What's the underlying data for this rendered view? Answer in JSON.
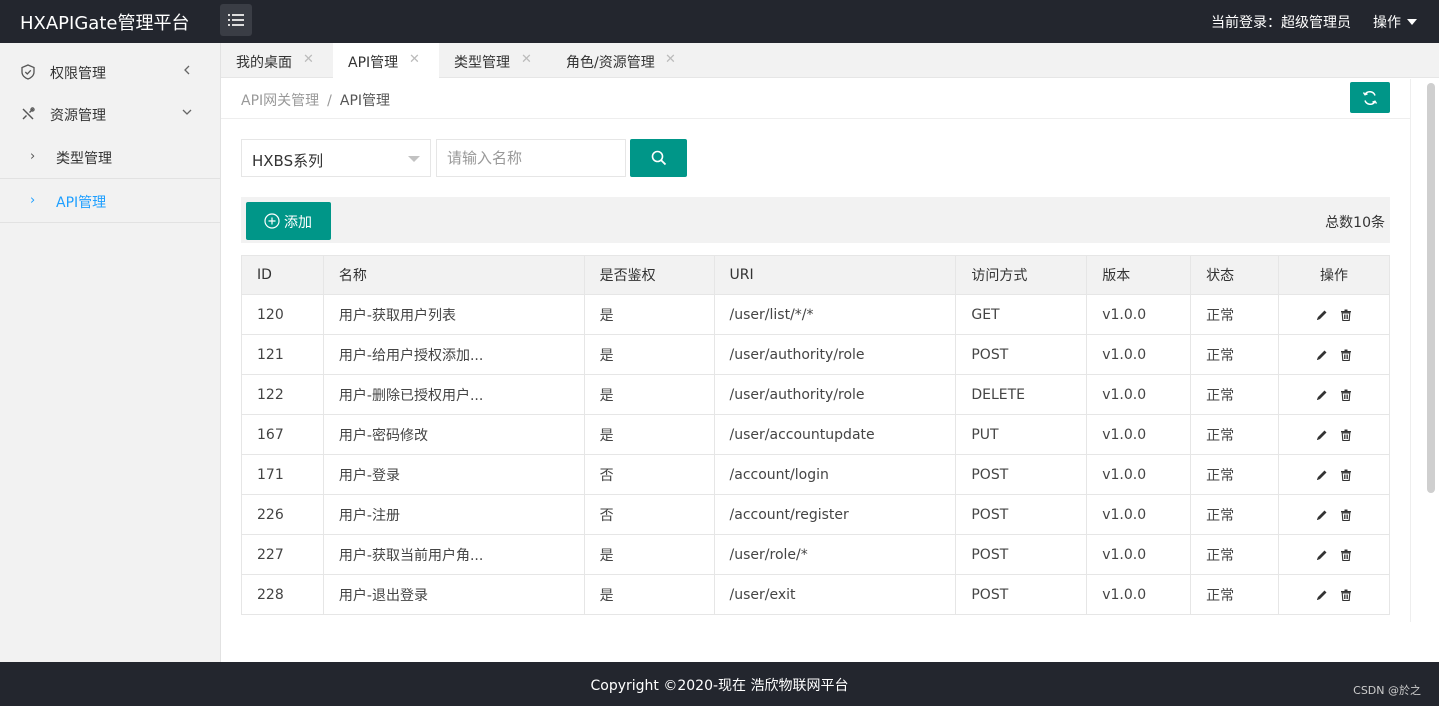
{
  "app": {
    "title": "HXAPIGate管理平台"
  },
  "header": {
    "login_text": "当前登录：超级管理员",
    "ops_label": "操作"
  },
  "sidebar": {
    "items": [
      {
        "label": "权限管理",
        "icon": "shield-check-icon",
        "arrow": "chevron-left-icon"
      },
      {
        "label": "资源管理",
        "icon": "tools-icon",
        "arrow": "chevron-down-icon"
      }
    ],
    "sub_items": [
      {
        "label": "类型管理",
        "active": false
      },
      {
        "label": "API管理",
        "active": true
      }
    ]
  },
  "tabs": [
    {
      "label": "我的桌面",
      "active": false
    },
    {
      "label": "API管理",
      "active": true
    },
    {
      "label": "类型管理",
      "active": false
    },
    {
      "label": "角色/资源管理",
      "active": false
    }
  ],
  "breadcrumb": {
    "parent": "API网关管理",
    "sep": "/",
    "current": "API管理"
  },
  "filters": {
    "series_selected": "HXBS系列",
    "name_placeholder": "请输入名称"
  },
  "toolbar": {
    "add_label": "添加",
    "total_text": "总数10条"
  },
  "table": {
    "headers": [
      "ID",
      "名称",
      "是否鉴权",
      "URI",
      "访问方式",
      "版本",
      "状态",
      "操作"
    ],
    "rows": [
      [
        "120",
        "用户-获取用户列表",
        "是",
        "/user/list/*/*",
        "GET",
        "v1.0.0",
        "正常"
      ],
      [
        "121",
        "用户-给用户授权添加...",
        "是",
        "/user/authority/role",
        "POST",
        "v1.0.0",
        "正常"
      ],
      [
        "122",
        "用户-删除已授权用户...",
        "是",
        "/user/authority/role",
        "DELETE",
        "v1.0.0",
        "正常"
      ],
      [
        "167",
        "用户-密码修改",
        "是",
        "/user/accountupdate",
        "PUT",
        "v1.0.0",
        "正常"
      ],
      [
        "171",
        "用户-登录",
        "否",
        "/account/login",
        "POST",
        "v1.0.0",
        "正常"
      ],
      [
        "226",
        "用户-注册",
        "否",
        "/account/register",
        "POST",
        "v1.0.0",
        "正常"
      ],
      [
        "227",
        "用户-获取当前用户角...",
        "是",
        "/user/role/*",
        "POST",
        "v1.0.0",
        "正常"
      ],
      [
        "228",
        "用户-退出登录",
        "是",
        "/user/exit",
        "POST",
        "v1.0.0",
        "正常"
      ]
    ]
  },
  "footer": {
    "copyright": "Copyright ©2020-现在 浩欣物联网平台",
    "watermark": "CSDN @於之"
  },
  "colors": {
    "accent": "#009688",
    "topbar": "#23262e",
    "active_link": "#1e9fff"
  }
}
